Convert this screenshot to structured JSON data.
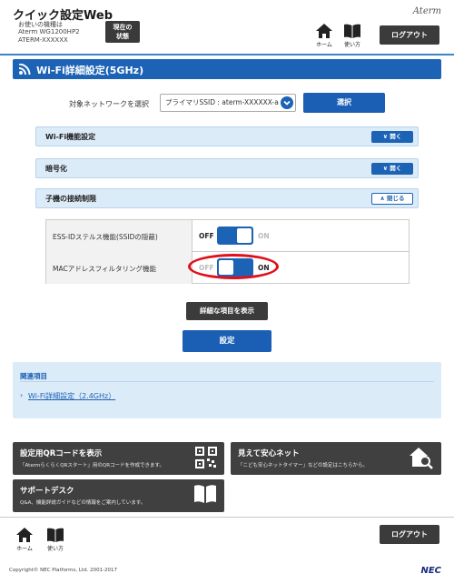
{
  "header": {
    "app_title": "クイック設定Web",
    "device_line1": "お使いの機種は",
    "device_line2": "Aterm WG1200HP2",
    "device_line3": "ATERM-XXXXXX",
    "status_button_l1": "現在の",
    "status_button_l2": "状態",
    "brand": "Aterm",
    "home_label": "ホーム",
    "help_label": "使い方",
    "logout_label": "ログアウト"
  },
  "page": {
    "title": "Wi-Fi詳細設定(5GHz)",
    "network_label": "対象ネットワークを選択",
    "network_selected": "プライマリSSID : aterm-XXXXXX-a",
    "select_button": "選択"
  },
  "sections": [
    {
      "label": "Wi-Fi機能設定",
      "button": "開く"
    },
    {
      "label": "暗号化",
      "button": "開く"
    },
    {
      "label": "子機の接続制限",
      "button": "閉じる"
    }
  ],
  "settings": [
    {
      "label": "ESS-IDステルス機能(SSIDの隠蔽)",
      "off": "OFF",
      "on": "ON",
      "state": "off"
    },
    {
      "label": "MACアドレスフィルタリング機能",
      "off": "OFF",
      "on": "ON",
      "state": "on"
    }
  ],
  "actions": {
    "detail_button": "詳細な項目を表示",
    "save_button": "設定"
  },
  "related": {
    "title": "関連項目",
    "link": "Wi-Fi詳細設定（2.4GHz）"
  },
  "tiles": [
    {
      "title": "設定用QRコードを表示",
      "desc": "「AtermらくらくQRスタート」用のQRコードを作成できます。"
    },
    {
      "title": "見えて安心ネット",
      "desc": "「こども安心ネットタイマー」などの設定はこちらから。"
    },
    {
      "title": "サポートデスク",
      "desc": "Q&A、機能詳説ガイドなどの情報をご案内しています。"
    }
  ],
  "footer": {
    "home_label": "ホーム",
    "help_label": "使い方",
    "logout_label": "ログアウト",
    "copyright": "Copyright© NEC Platforms, Ltd. 2001-2017",
    "brand": "NEC"
  },
  "colors": {
    "primary": "#1c63b6",
    "panel": "#dcebf8",
    "dark_button": "#3b3b3b",
    "highlight": "#e0101b"
  }
}
